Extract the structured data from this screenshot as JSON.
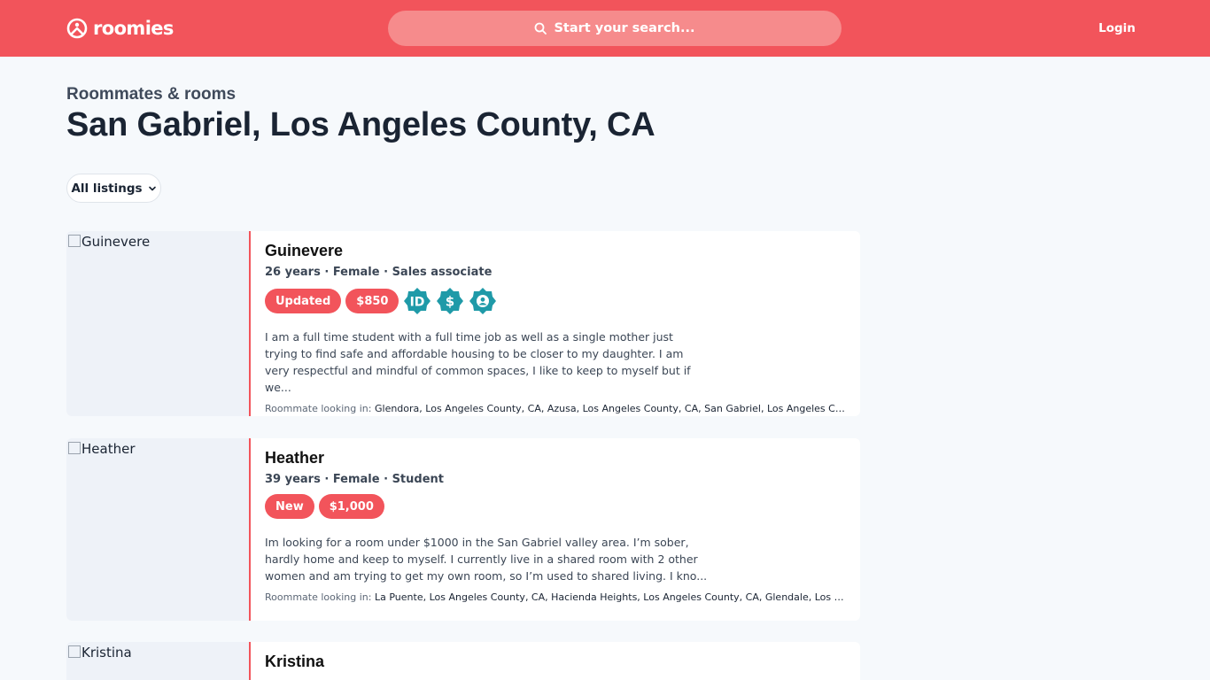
{
  "header": {
    "brand": "roomies",
    "search_placeholder": "Start your search...",
    "login_label": "Login",
    "accent_color": "#f2545b"
  },
  "page": {
    "eyebrow": "Roommates & rooms",
    "title": "San Gabriel, Los Angeles County, CA",
    "filter_label": "All listings"
  },
  "listings": [
    {
      "photo_alt": "Guinevere",
      "name": "Guinevere",
      "meta": "26 years · Female · Sales associate",
      "status": "Updated",
      "price": "$850",
      "verifications": [
        "id-verified-icon",
        "income-verified-icon",
        "background-check-icon"
      ],
      "verify_labels": [
        "ID",
        "$"
      ],
      "description": "I am a full time student with a full time job as well as a single mother just trying to find safe and affordable housing to be closer to my daughter. I am very respectful and mindful of common spaces, I like to keep to myself but if we...",
      "looking_label": "Roommate looking in:",
      "looking_in": "Glendora, Los Angeles County, CA, Azusa, Los Angeles County, CA, San Gabriel, Los Angeles County..."
    },
    {
      "photo_alt": "Heather",
      "name": "Heather",
      "meta": "39 years · Female · Student",
      "status": "New",
      "price": "$1,000",
      "description": "Im looking for a room under $1000 in the San Gabriel valley area. I’m sober, hardly home and keep to myself. I currently live in a shared room with 2 other women and am trying to get my own room, so I’m used to shared living. I kno...",
      "looking_label": "Roommate looking in:",
      "looking_in": "La Puente, Los Angeles County, CA, Hacienda Heights, Los Angeles County, CA, Glendale, Los Angel..."
    },
    {
      "photo_alt": "Kristina",
      "name": "Kristina"
    }
  ]
}
